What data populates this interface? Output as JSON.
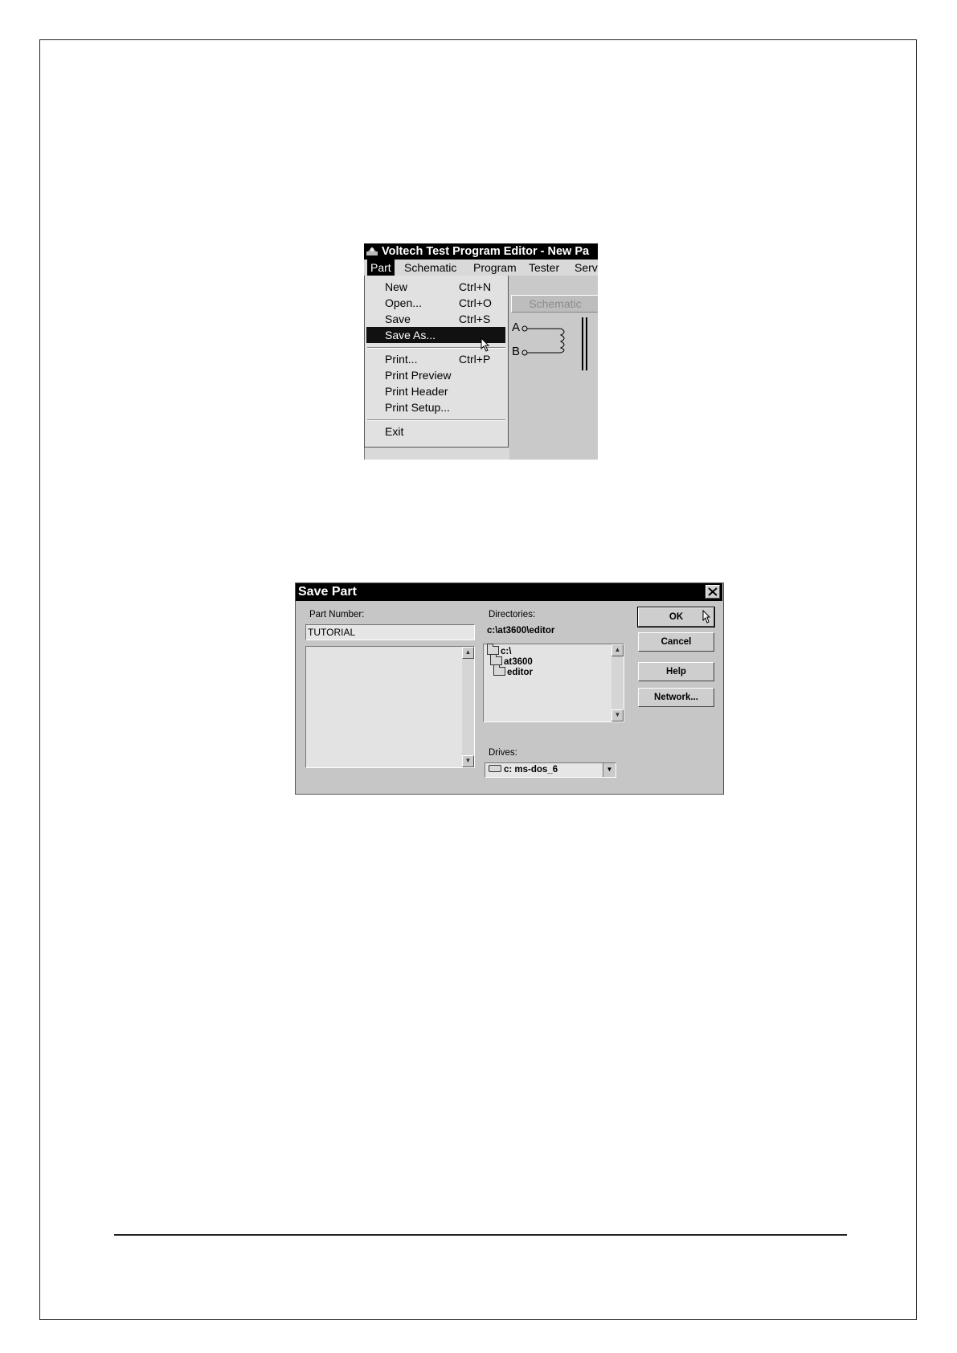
{
  "menu_screenshot": {
    "title": "Voltech Test Program Editor - New Pa",
    "menubar": [
      "Part",
      "Schematic",
      "Program",
      "Tester",
      "Serv"
    ],
    "tab_label": "Schematic",
    "schematic_labels": {
      "a": "A",
      "b": "B"
    },
    "menu_items": [
      {
        "label": "New",
        "shortcut": "Ctrl+N"
      },
      {
        "label": "Open...",
        "shortcut": "Ctrl+O"
      },
      {
        "label": "Save",
        "shortcut": "Ctrl+S"
      },
      {
        "label": "Save As...",
        "shortcut": ""
      },
      {
        "label": "Print...",
        "shortcut": "Ctrl+P"
      },
      {
        "label": "Print Preview",
        "shortcut": ""
      },
      {
        "label": "Print Header",
        "shortcut": ""
      },
      {
        "label": "Print Setup...",
        "shortcut": ""
      },
      {
        "label": "Exit",
        "shortcut": ""
      }
    ],
    "highlighted_item": "Save As..."
  },
  "save_dialog": {
    "title": "Save Part",
    "part_number_label": "Part Number:",
    "part_number_value": "TUTORIAL",
    "directories_label": "Directories:",
    "current_directory": "c:\\at3600\\editor",
    "directory_tree": [
      "c:\\",
      "at3600",
      "editor"
    ],
    "drives_label": "Drives:",
    "drive_value": "c: ms-dos_6",
    "buttons": {
      "ok": "OK",
      "cancel": "Cancel",
      "help": "Help",
      "network": "Network..."
    }
  },
  "icons": [
    "app-icon",
    "close-icon",
    "folder-icon",
    "drive-icon",
    "arrow-cursor-icon"
  ]
}
